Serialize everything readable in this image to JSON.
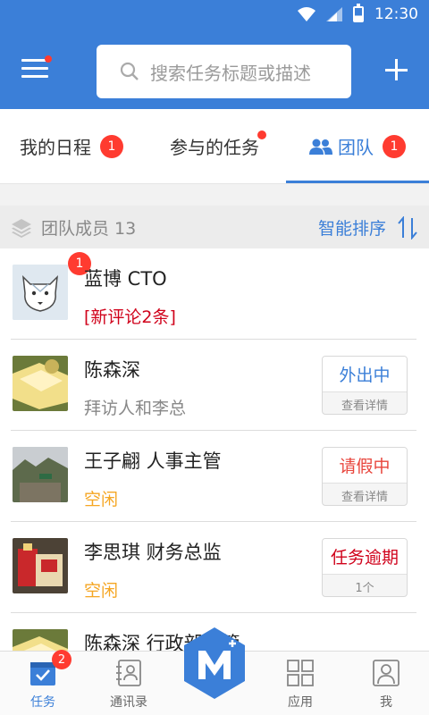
{
  "status_bar": {
    "time": "12:30"
  },
  "header": {
    "search_placeholder": "搜索任务标题或描述"
  },
  "tabs": [
    {
      "label": "我的日程",
      "badge": "1"
    },
    {
      "label": "参与的任务"
    },
    {
      "label": "团队",
      "badge": "1"
    }
  ],
  "section": {
    "title": "团队成员 13",
    "sort_label": "智能排序"
  },
  "members": [
    {
      "name": "蓝博 CTO",
      "subtitle": "[新评论2条]",
      "badge": "1"
    },
    {
      "name": "陈森深",
      "subtitle": "拜访人和李总",
      "status": "外出中",
      "action": "查看详情"
    },
    {
      "name": "王子翩 人事主管",
      "subtitle": "空闲",
      "status": "请假中",
      "action": "查看详情"
    },
    {
      "name": "李思琪 财务总监",
      "subtitle": "空闲",
      "status": "任务逾期",
      "action": "1个"
    },
    {
      "name": "陈森深 行政部主管"
    }
  ],
  "colors": {
    "primary": "#3b7fd8",
    "badge": "#ff3b30",
    "out": "#3b7fd8",
    "leave": "#e8453c",
    "overdue": "#d0021b",
    "idle": "#f5a623"
  },
  "bottom_nav": [
    {
      "label": "任务",
      "badge": "2",
      "icon": "tasks-icon"
    },
    {
      "label": "通讯录",
      "icon": "contacts-icon"
    },
    {
      "label": "",
      "icon": "app-logo-icon"
    },
    {
      "label": "应用",
      "icon": "apps-grid-icon"
    },
    {
      "label": "我",
      "icon": "profile-icon"
    }
  ]
}
